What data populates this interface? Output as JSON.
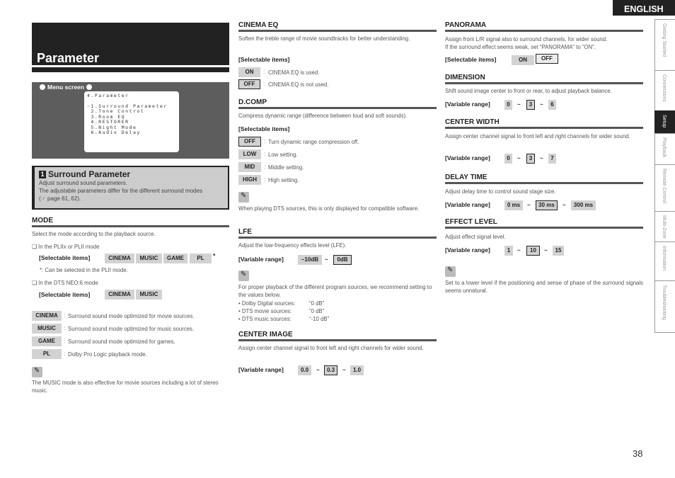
{
  "language": "ENGLISH",
  "page_number": "38",
  "side_tabs": [
    {
      "label": "Getting Started",
      "active": false
    },
    {
      "label": "Connections",
      "active": false
    },
    {
      "label": "Setup",
      "active": true
    },
    {
      "label": "Playback",
      "active": false
    },
    {
      "label": "Remote Control",
      "active": false
    },
    {
      "label": "Multi-Zone",
      "active": false
    },
    {
      "label": "Information",
      "active": false
    },
    {
      "label": "Troubleshooting",
      "active": false
    }
  ],
  "title": "Parameter",
  "menu_screen": {
    "label": "Menu screen",
    "header": "4.Parameter",
    "items": [
      "☞1.Surround Parameter",
      " 2.Tone Control",
      " 3.Room EQ",
      " 4.RESTORER",
      " 5.Night Mode",
      " 6.Audio Delay"
    ]
  },
  "surround_parameter": {
    "number": "1",
    "heading": "Surround Parameter",
    "line1": "Adjust surround sound parameters.",
    "line2": "The adjustable parameters differ for the different surround modes",
    "line3": "(☞ page 61, 62)."
  },
  "mode": {
    "heading": "MODE",
    "desc": "Select the mode according to the playback source.",
    "pl_mode_label": "❑ In the PLIIx or PLII mode",
    "selectable_label": "[Selectable items]",
    "pl_items": [
      "CINEMA",
      "MUSIC",
      "GAME",
      "PL"
    ],
    "asterisk": "*",
    "asterisk_note": "*:  Can be selected in the PLII mode.",
    "dts_mode_label": "❑ In the DTS NEO:6 mode",
    "dts_items": [
      "CINEMA",
      "MUSIC"
    ],
    "defs": [
      {
        "item": "CINEMA",
        "desc": "Surround sound mode optimized for movie sources."
      },
      {
        "item": "MUSIC",
        "desc": "Surround sound mode optimized for music sources."
      },
      {
        "item": "GAME",
        "desc": "Surround sound mode optimized for games."
      },
      {
        "item": "PL",
        "desc": "Dolby Pro Logic playback mode."
      }
    ],
    "note": "The MUSIC mode is also effective for movie sources including a lot of stereo music."
  },
  "cinema_eq": {
    "heading": "CINEMA EQ",
    "desc": "Soften the treble range of movie soundtracks for better understanding.",
    "selectable_label": "[Selectable items]",
    "defs": [
      {
        "item": "ON",
        "desc": "CINEMA EQ is used."
      },
      {
        "item": "OFF",
        "desc": "CINEMA EQ is not used."
      }
    ]
  },
  "dcomp": {
    "heading": "D.COMP",
    "desc": "Compress dynamic range (difference between loud and soft sounds).",
    "selectable_label": "[Selectable items]",
    "defs": [
      {
        "item": "OFF",
        "desc": "Turn dynamic range compression off."
      },
      {
        "item": "LOW",
        "desc": "Low setting."
      },
      {
        "item": "MID",
        "desc": "Middle setting."
      },
      {
        "item": "HIGH",
        "desc": "High setting."
      }
    ],
    "note": "When playing DTS sources, this is only displayed for compatible software."
  },
  "lfe": {
    "heading": "LFE",
    "desc": "Adjust the low-frequency effects level (LFE).",
    "range_label": "[Variable range]",
    "min": "–10dB",
    "max": "0dB",
    "tilde": "~",
    "note": "For proper playback of the different program sources, we recommend setting to the values below.",
    "bullets": [
      {
        "label": "• Dolby Digital sources:",
        "value": "“0 dB”"
      },
      {
        "label": "• DTS movie sources:",
        "value": "“0 dB”"
      },
      {
        "label": "• DTS music sources:",
        "value": "“-10 dB”"
      }
    ]
  },
  "center_image": {
    "heading": "CENTER IMAGE",
    "desc": "Assign center channel signal to front left and right channels for wider sound.",
    "range_label": "[Variable range]",
    "min": "0.0",
    "default": "0.3",
    "max": "1.0",
    "tilde": "~"
  },
  "panorama": {
    "heading": "PANORAMA",
    "desc1": "Assign front L/R signal also to surround channels, for wider sound.",
    "desc2": "If the surround effect seems weak, set “PANORAMA” to “ON”.",
    "selectable_label": "[Selectable items]",
    "on": "ON",
    "off": "OFF"
  },
  "dimension": {
    "heading": "DIMENSION",
    "desc": "Shift sound image center to front or rear, to adjust playback balance.",
    "range_label": "[Variable range]",
    "min": "0",
    "default": "3",
    "max": "6",
    "tilde": "~"
  },
  "center_width": {
    "heading": "CENTER WIDTH",
    "desc": "Assign center channel signal to front left and right channels for wider sound.",
    "range_label": "[Variable range]",
    "min": "0",
    "default": "3",
    "max": "7",
    "tilde": "~"
  },
  "delay_time": {
    "heading": "DELAY TIME",
    "desc": "Adjust delay time to control sound stage size.",
    "range_label": "[Variable range]",
    "min": "0 ms",
    "default": "30 ms",
    "max": "300 ms",
    "tilde": "~"
  },
  "effect_level": {
    "heading": "EFFECT LEVEL",
    "desc": "Adjust effect signal level.",
    "range_label": "[Variable range]",
    "min": "1",
    "default": "10",
    "max": "15",
    "tilde": "~",
    "note": "Set to a lower level if the positioning and sense of phase of the surround signals seems unnatural."
  }
}
